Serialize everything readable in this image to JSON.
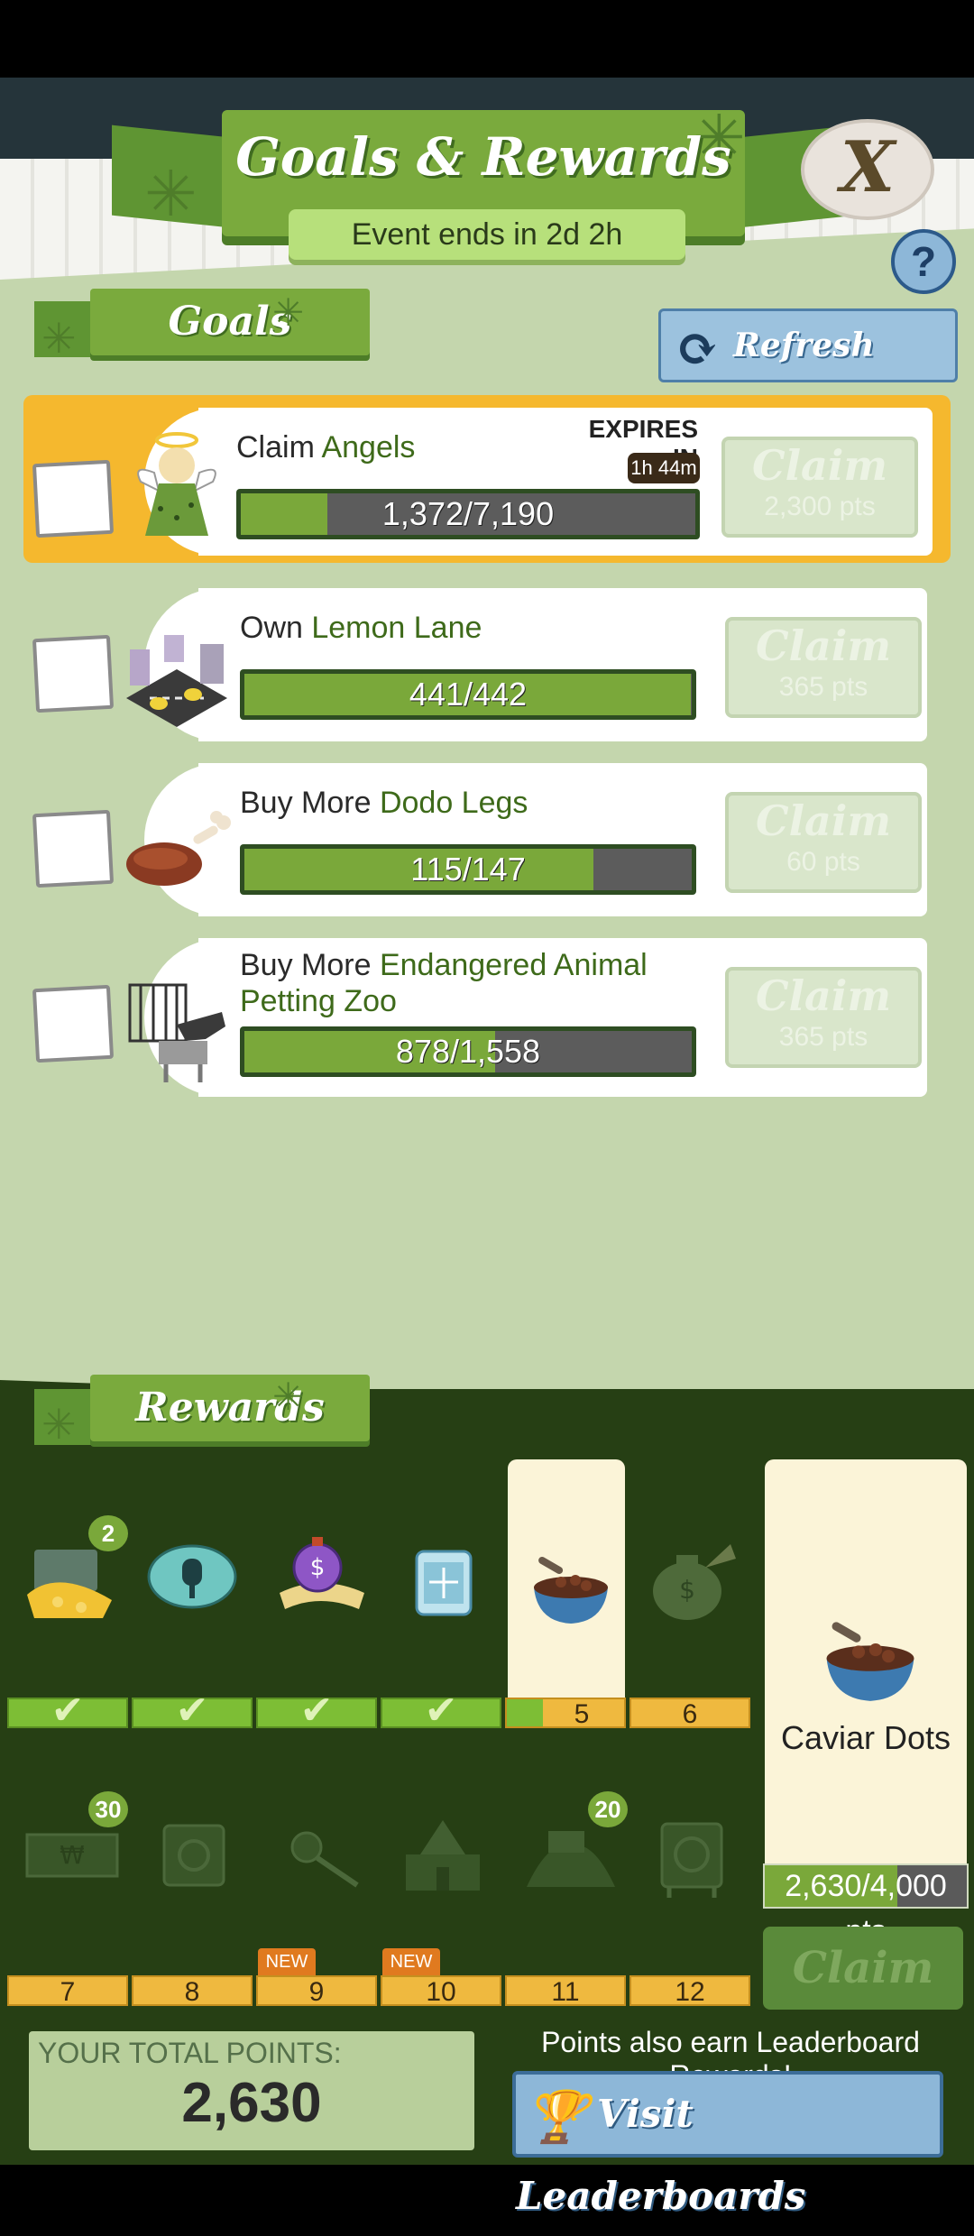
{
  "header": {
    "title": "Goals & Rewards",
    "event_text": "Event ends in 2d 2h",
    "close_label": "X",
    "help_label": "?"
  },
  "goals_section": {
    "tab_label": "Goals",
    "refresh_label": "Refresh Goals",
    "expires_label": "EXPIRES IN",
    "expires_time": "1h 44m",
    "items": [
      {
        "prefix": "Claim ",
        "target": "Angels",
        "progress_text": "1,372/7,190",
        "progress": 0.19,
        "claim_label": "Claim",
        "claim_pts": "2,300 pts"
      },
      {
        "prefix": "Own ",
        "target": "Lemon Lane",
        "progress_text": "441/442",
        "progress": 0.998,
        "claim_label": "Claim",
        "claim_pts": "365 pts"
      },
      {
        "prefix": "Buy More ",
        "target": "Dodo Legs",
        "progress_text": "115/147",
        "progress": 0.78,
        "claim_label": "Claim",
        "claim_pts": "60 pts"
      },
      {
        "prefix": "Buy More ",
        "target": "Endangered Animal Petting Zoo",
        "progress_text": "878/1,558",
        "progress": 0.56,
        "claim_label": "Claim",
        "claim_pts": "365 pts"
      }
    ]
  },
  "rewards_section": {
    "tab_label": "Rewards",
    "row1_badge": "2",
    "row1_check": "✔",
    "row1_slots": [
      "5",
      "6"
    ],
    "row2_badges": [
      "30",
      "20"
    ],
    "row2_slots": [
      "7",
      "8",
      "9",
      "10",
      "11",
      "12"
    ],
    "new_label": "NEW",
    "featured_name": "Caviar Dots",
    "featured_progress_text": "2,630/4,000 pts",
    "featured_progress": 0.6575,
    "claim_label": "Claim"
  },
  "footer": {
    "total_label": "YOUR TOTAL POINTS:",
    "total_value": "2,630",
    "leaderboard_hint": "Points also earn Leaderboard Rewards!",
    "leaderboard_button": "Visit Leaderboards"
  },
  "icons": {
    "goal_icons": [
      "angel-icon",
      "lemon-lane-icon",
      "dodo-leg-icon",
      "petting-zoo-icon"
    ],
    "reward_icons": [
      "treasure-chest-icon",
      "popsicle-icon",
      "stopwatch-cash-icon",
      "ice-block-icon",
      "caviar-bowl-icon",
      "money-bag-icon",
      "cash-bill-icon",
      "safe-icon",
      "pot-icon",
      "mansion-icon",
      "treasure-pile-icon",
      "vault-icon"
    ]
  },
  "colors": {
    "accent_green": "#7aaa3d",
    "highlight": "#f5b82e",
    "rewards_bg": "#263f14"
  }
}
